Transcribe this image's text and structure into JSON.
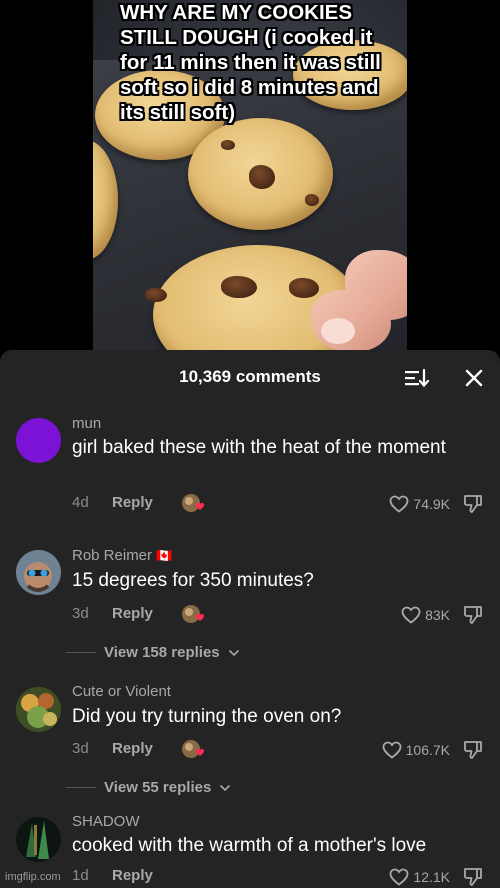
{
  "video": {
    "caption": "WHY ARE MY COOKIES STILL DOUGH (i cooked it for 11 mins then it was still soft so i did 8 minutes and its still soft)"
  },
  "comments_panel": {
    "count_label": "10,369 comments",
    "sort_icon": "sort-icon",
    "close_icon": "close-icon"
  },
  "comments": [
    {
      "username": "mun",
      "flag": "",
      "text": "girl baked these with the heat of the moment",
      "age": "4d",
      "reply_label": "Reply",
      "likes": "74.9K",
      "avatar_color": "#7b12d6"
    },
    {
      "username": "Rob Reimer",
      "flag": "🇨🇦",
      "text": "15 degrees for 350 minutes?",
      "age": "3d",
      "reply_label": "Reply",
      "likes": "83K",
      "view_replies": "View 158 replies"
    },
    {
      "username": "Cute or Violent",
      "flag": "",
      "text": "Did you try turning the oven on?",
      "age": "3d",
      "reply_label": "Reply",
      "likes": "106.7K",
      "view_replies": "View 55 replies"
    },
    {
      "username": "SHADOW",
      "flag": "",
      "text": "cooked with the warmth of a mother's love",
      "age": "1d",
      "reply_label": "Reply",
      "likes": "12.1K"
    }
  ],
  "watermark": "imgflip.com",
  "colors": {
    "sheet_bg": "#242424",
    "heart_red": "#fe2c55",
    "muted_text": "#a8a8a8"
  }
}
